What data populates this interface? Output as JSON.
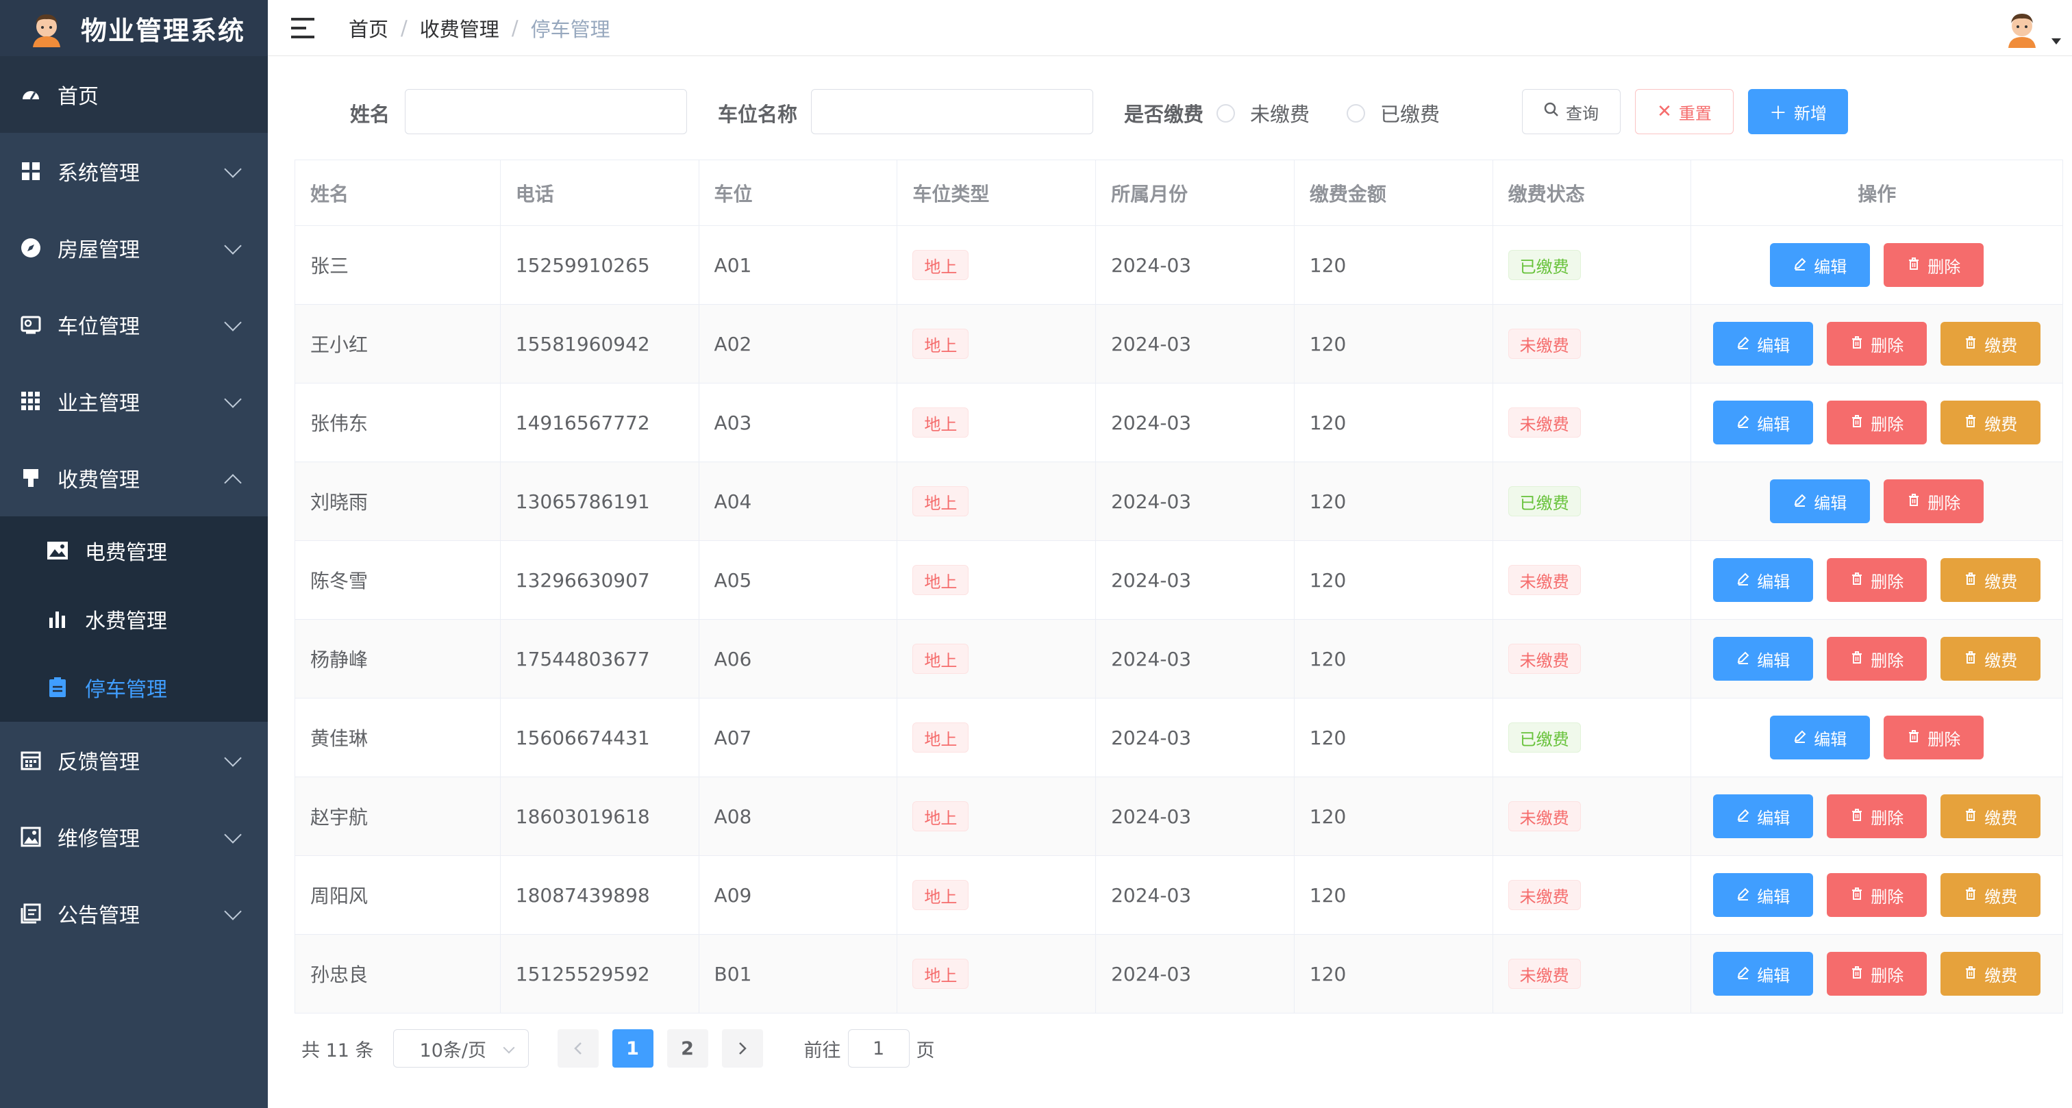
{
  "app": {
    "title": "物业管理系统"
  },
  "sidebar": {
    "items": [
      {
        "label": "首页",
        "icon": "dashboard-icon"
      },
      {
        "label": "系统管理",
        "icon": "grid-icon"
      },
      {
        "label": "房屋管理",
        "icon": "compass-icon"
      },
      {
        "label": "车位管理",
        "icon": "parking-icon"
      },
      {
        "label": "业主管理",
        "icon": "apps-icon"
      },
      {
        "label": "收费管理",
        "icon": "pay-icon"
      },
      {
        "label": "反馈管理",
        "icon": "calendar-icon"
      },
      {
        "label": "维修管理",
        "icon": "picture-icon"
      },
      {
        "label": "公告管理",
        "icon": "notice-icon"
      }
    ],
    "submenu": [
      {
        "label": "电费管理",
        "icon": "image-icon"
      },
      {
        "label": "水费管理",
        "icon": "bar-chart-icon"
      },
      {
        "label": "停车管理",
        "icon": "clipboard-icon"
      }
    ]
  },
  "breadcrumb": [
    "首页",
    "收费管理",
    "停车管理"
  ],
  "search": {
    "name_label": "姓名",
    "name_value": "",
    "space_label": "车位名称",
    "space_value": "",
    "paid_label": "是否缴费",
    "unpaid_option": "未缴费",
    "paid_option": "已缴费",
    "query_label": "查询",
    "reset_label": "重置",
    "add_label": "新增"
  },
  "table": {
    "headers": [
      "姓名",
      "电话",
      "车位",
      "车位类型",
      "所属月份",
      "缴费金额",
      "缴费状态",
      "操作"
    ],
    "actions": {
      "edit": "编辑",
      "delete": "删除",
      "pay": "缴费"
    },
    "rows": [
      {
        "name": "张三",
        "phone": "15259910265",
        "space": "A01",
        "type": "地上",
        "month": "2024-03",
        "amount": "120",
        "status": "已缴费",
        "paid": true
      },
      {
        "name": "王小红",
        "phone": "15581960942",
        "space": "A02",
        "type": "地上",
        "month": "2024-03",
        "amount": "120",
        "status": "未缴费",
        "paid": false
      },
      {
        "name": "张伟东",
        "phone": "14916567772",
        "space": "A03",
        "type": "地上",
        "month": "2024-03",
        "amount": "120",
        "status": "未缴费",
        "paid": false
      },
      {
        "name": "刘晓雨",
        "phone": "13065786191",
        "space": "A04",
        "type": "地上",
        "month": "2024-03",
        "amount": "120",
        "status": "已缴费",
        "paid": true
      },
      {
        "name": "陈冬雪",
        "phone": "13296630907",
        "space": "A05",
        "type": "地上",
        "month": "2024-03",
        "amount": "120",
        "status": "未缴费",
        "paid": false
      },
      {
        "name": "杨静峰",
        "phone": "17544803677",
        "space": "A06",
        "type": "地上",
        "month": "2024-03",
        "amount": "120",
        "status": "未缴费",
        "paid": false
      },
      {
        "name": "黄佳琳",
        "phone": "15606674431",
        "space": "A07",
        "type": "地上",
        "month": "2024-03",
        "amount": "120",
        "status": "已缴费",
        "paid": true
      },
      {
        "name": "赵宇航",
        "phone": "18603019618",
        "space": "A08",
        "type": "地上",
        "month": "2024-03",
        "amount": "120",
        "status": "未缴费",
        "paid": false
      },
      {
        "name": "周阳风",
        "phone": "18087439898",
        "space": "A09",
        "type": "地上",
        "month": "2024-03",
        "amount": "120",
        "status": "未缴费",
        "paid": false
      },
      {
        "name": "孙忠良",
        "phone": "15125529592",
        "space": "B01",
        "type": "地上",
        "month": "2024-03",
        "amount": "120",
        "status": "未缴费",
        "paid": false
      }
    ]
  },
  "pagination": {
    "total": "共 11 条",
    "page_size": "10条/页",
    "pages": [
      "1",
      "2"
    ],
    "current": "1",
    "goto_prefix": "前往",
    "goto_value": "1",
    "goto_suffix": "页"
  },
  "colors": {
    "primary": "#409eff",
    "danger": "#f56c6c",
    "warning": "#e6a23c",
    "success": "#67c23a",
    "sidebar": "#304156"
  }
}
